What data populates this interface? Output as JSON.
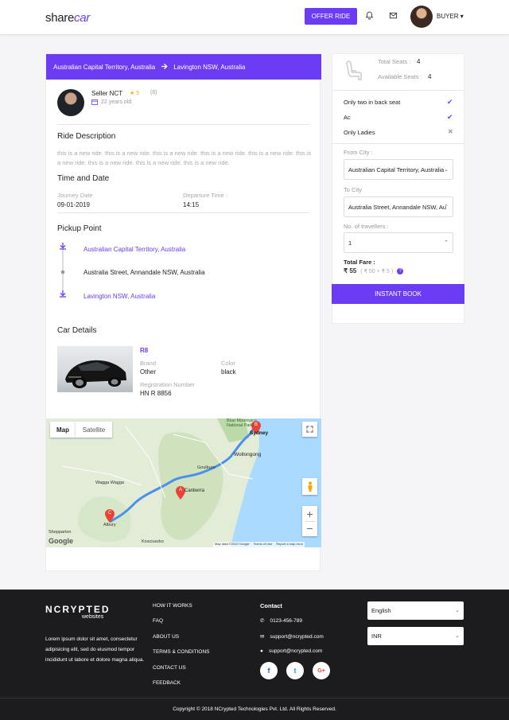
{
  "header": {
    "logo_share": "share",
    "logo_car": "car",
    "offer_ride": "OFFER RIDE",
    "user_role": "BUYER"
  },
  "route": {
    "from": "Australian Capital Territory, Australia",
    "to": "Lavington NSW, Australia"
  },
  "seller": {
    "name": "Seller NCT",
    "rating": "5",
    "count": "(6)",
    "age": "22 years old"
  },
  "ride_description": {
    "title": "Ride Description",
    "text": "this is a new ride. this is a new ride. this is a new ride. this is a new ride. this is a new ride. this is a new ride. this is a new ride. this is a new ride. this is a new ride."
  },
  "time_date": {
    "title": "Time and Date",
    "journey_label": "Journey Date",
    "journey_value": "09-01-2019",
    "departure_label": "Departure Time :",
    "departure_value": "14:15"
  },
  "pickup": {
    "title": "Pickup Point",
    "points": [
      "Australian Capital Territory, Australia",
      "Australia Street, Annandale NSW, Australia",
      "Lavington NSW, Australia"
    ]
  },
  "car": {
    "title": "Car Details",
    "model": "R8",
    "brand_label": "Brand",
    "brand_value": "Other",
    "color_label": "Color",
    "color_value": "black",
    "reg_label": "Registration Number",
    "reg_value": "HN R 8856"
  },
  "map": {
    "tab_map": "Map",
    "tab_satellite": "Satellite",
    "marker_a": "A",
    "marker_b": "B",
    "marker_c": "C",
    "city_sydney": "Sydney",
    "city_wollongong": "Wollongong",
    "city_wagga": "Wagga Wagga",
    "city_canberra": "Canberra",
    "city_goulburn": "Goulburn",
    "city_albury": "Albury",
    "city_shepparton": "Shepparton",
    "city_kosciuszko": "Kosciuszko",
    "park": "Blue Mountains National Park",
    "footer": "Map data ©2019 Google",
    "terms": "Terms of Use",
    "report": "Report a map error",
    "google": "Google"
  },
  "booking": {
    "total_seats_label": "Total Seats :",
    "total_seats": "4",
    "available_seats_label": "Available Seats :",
    "available_seats": "4",
    "prefs": [
      {
        "label": "Only two in back seat",
        "ok": true
      },
      {
        "label": "Ac",
        "ok": true
      },
      {
        "label": "Only Ladies",
        "ok": false
      }
    ],
    "from_label": "From City :",
    "from_value": "Australian Capital Territory, Australia",
    "to_label": "To City",
    "to_value": "Australia Street, Annandale NSW, Au",
    "travellers_label": "No. of travellers :",
    "travellers_value": "1",
    "fare_label": "Total Fare :",
    "fare_value": "₹ 55",
    "fare_breakdown": "( ₹ 50 + ₹ 5 )",
    "instant_book": "INSTANT BOOK"
  },
  "footer": {
    "brand": "NCRYPTED",
    "brand_sub": "websites",
    "about": "Lorem ipsum dolor sit amet, consectetur adipisicing elit, sed do eiusmod tempor incididunt ut labore et dolore magna aliqua.",
    "links": [
      "HOW IT WORKS",
      "FAQ",
      "ABOUT US",
      "TERMS & CONDITIONS",
      "CONTACT US",
      "FEEDBACK"
    ],
    "contact_title": "Contact",
    "phone": "0123-456-789",
    "email1": "support@ncrypted.com",
    "email2": "support@ncrypted.com",
    "language": "English",
    "currency": "INR",
    "copyright": "Copyright © 2018 NCrypted Technologies Pvt. Ltd. All Rights Reserved."
  },
  "colors": {
    "accent": "#6c3cf5",
    "footer_bg": "#1c1c1e"
  }
}
